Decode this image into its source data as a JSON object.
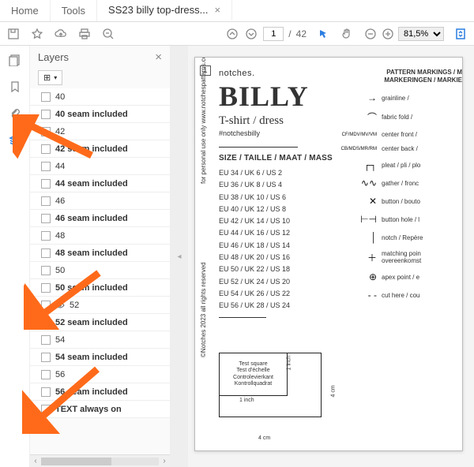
{
  "tabs": {
    "home": "Home",
    "tools": "Tools",
    "doc": "SS23 billy top-dress..."
  },
  "toolbar": {
    "page_current": "1",
    "page_total": "42",
    "zoom": "81,5%"
  },
  "panel": {
    "title": "Layers",
    "opts_label": "⊞",
    "items": [
      {
        "label": "40",
        "bold": false,
        "vis": false
      },
      {
        "label": "40 seam included",
        "bold": true,
        "vis": false
      },
      {
        "label": "42",
        "bold": false,
        "vis": false
      },
      {
        "label": "42 seam included",
        "bold": true,
        "vis": false
      },
      {
        "label": "44",
        "bold": false,
        "vis": false
      },
      {
        "label": "44 seam included",
        "bold": true,
        "vis": false
      },
      {
        "label": "46",
        "bold": false,
        "vis": false
      },
      {
        "label": "46 seam included",
        "bold": true,
        "vis": false
      },
      {
        "label": "48",
        "bold": false,
        "vis": false
      },
      {
        "label": "48 seam included",
        "bold": true,
        "vis": false
      },
      {
        "label": "50",
        "bold": false,
        "vis": false
      },
      {
        "label": "50 seam included",
        "bold": true,
        "vis": false
      },
      {
        "label": "52",
        "bold": false,
        "vis": true
      },
      {
        "label": "52 seam included",
        "bold": true,
        "vis": false
      },
      {
        "label": "54",
        "bold": false,
        "vis": false
      },
      {
        "label": "54 seam included",
        "bold": true,
        "vis": false
      },
      {
        "label": "56",
        "bold": false,
        "vis": false
      },
      {
        "label": "56 seam included",
        "bold": true,
        "vis": false
      },
      {
        "label": "TEXT always on",
        "bold": true,
        "vis": false
      }
    ]
  },
  "doc": {
    "page_badge": "1",
    "brand_small": "notches.",
    "brand_big": "BILLY",
    "subtitle": "T-shirt / dress",
    "hashtag": "#notchesbilly",
    "size_head": "SIZE / TAILLE / MAAT / MASS",
    "sizes": [
      "EU 34 / UK 6 / US 2",
      "EU 36 / UK 8 / US 4",
      "EU 38 / UK 10 / US 6",
      "EU 40 / UK 12 / US 8",
      "EU 42 / UK 14 / US 10",
      "EU 44 / UK 16 / US 12",
      "EU 46 / UK 18 / US 14",
      "EU 48 / UK 20 / US 16",
      "EU 50 / UK 22 / US 18",
      "EU 52 / UK 24 / US 20",
      "EU 54 / UK 26 / US 22",
      "EU 56 / UK 28 / US 24"
    ],
    "legend_head": "PATTERN MARKINGS / M\nMARKERINGEN / MARKIE",
    "legend": [
      {
        "sym": "→",
        "txt": "grainline / "
      },
      {
        "sym": "⌒",
        "txt": "fabric fold / "
      },
      {
        "sym": "CF/MDV/MV/VM",
        "txt": "center front / "
      },
      {
        "sym": "CB/MDS/MR/RM",
        "txt": "center back / "
      },
      {
        "sym": "┌┐",
        "txt": "pleat / pli / plo"
      },
      {
        "sym": "∿∿",
        "txt": "gather / fronc"
      },
      {
        "sym": "✕",
        "txt": "button / bouto"
      },
      {
        "sym": "⊢⊣",
        "txt": "button hole / l"
      },
      {
        "sym": "│",
        "txt": "notch / Repère"
      },
      {
        "sym": "＋",
        "txt": "matching poin\novereenkomst"
      },
      {
        "sym": "⊕",
        "txt": "apex point / e"
      },
      {
        "sym": "- -",
        "txt": "cut here / cou"
      }
    ],
    "test": {
      "l1": "Test square",
      "l2": "Test d'échelle",
      "l3": "Controlevierkant",
      "l4": "Kontrollquadrat",
      "dim_outer": "4 cm",
      "dim_inner": "1 inch"
    },
    "copyright": "for personal use only    www.notchespatterns.com",
    "copyright2": "©Notches 2023   all rights reserved"
  }
}
